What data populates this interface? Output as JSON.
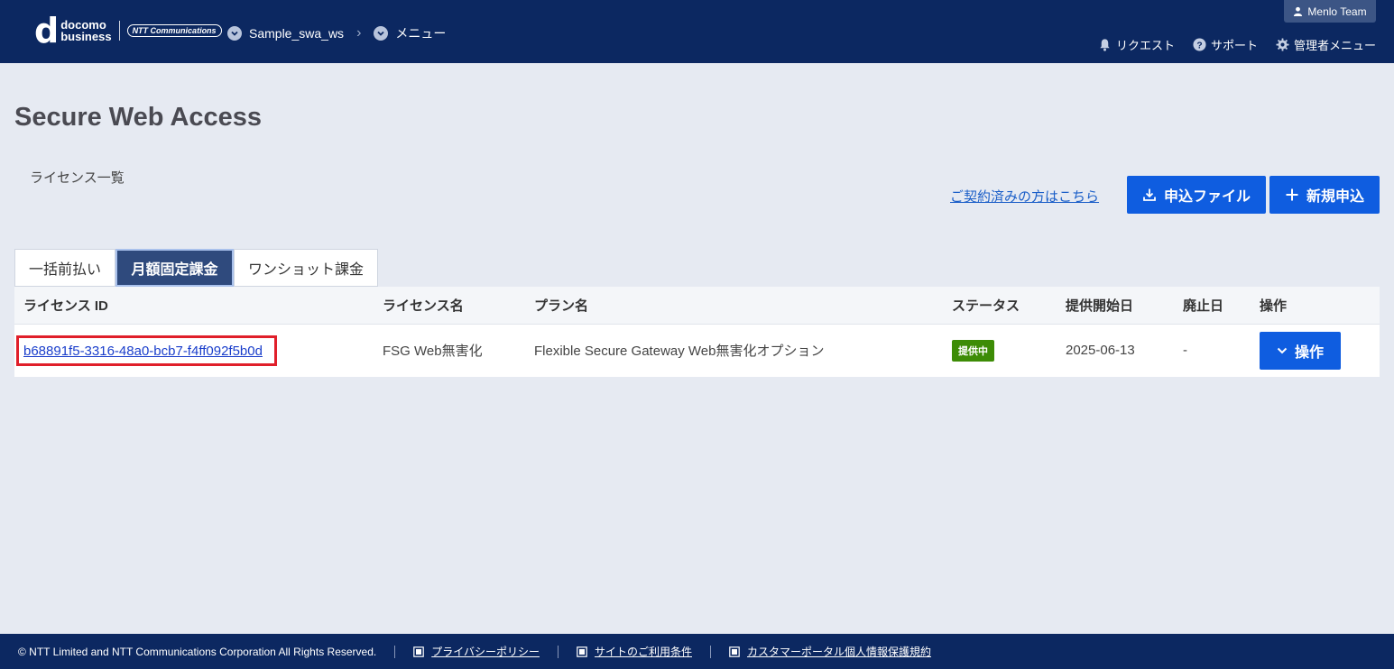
{
  "header": {
    "logo": {
      "brand_top": "docomo",
      "brand_bottom": "business",
      "partner": "NTT Communications"
    },
    "breadcrumb": [
      {
        "label": "Sample_swa_ws"
      },
      {
        "label": "メニュー"
      }
    ],
    "user": "Menlo Team",
    "links": {
      "request": "リクエスト",
      "support": "サポート",
      "admin": "管理者メニュー"
    }
  },
  "page": {
    "title": "Secure Web Access",
    "subtitle": "ライセンス一覧",
    "contract_link": "ご契約済みの方はこちら",
    "btn_file": "申込ファイル",
    "btn_new": "新規申込"
  },
  "tabs": [
    {
      "label": "一括前払い",
      "active": false
    },
    {
      "label": "月額固定課金",
      "active": true
    },
    {
      "label": "ワンショット課金",
      "active": false
    }
  ],
  "table": {
    "headers": [
      "ライセンス ID",
      "ライセンス名",
      "プラン名",
      "ステータス",
      "提供開始日",
      "廃止日",
      "操作"
    ],
    "rows": [
      {
        "license_id": "b68891f5-3316-48a0-bcb7-f4ff092f5b0d",
        "license_name": "FSG Web無害化",
        "plan_name": "Flexible Secure Gateway Web無害化オプション",
        "status": "提供中",
        "start_date": "2025-06-13",
        "end_date": "-",
        "action": "操作"
      }
    ]
  },
  "footer": {
    "copyright": "© NTT Limited and NTT Communications Corporation All Rights Reserved.",
    "links": [
      "プライバシーポリシー",
      "サイトのご利用条件",
      "カスタマーポータル個人情報保護規約"
    ]
  },
  "colors": {
    "header_bg": "#0c2861",
    "primary": "#0f5de0",
    "status_active": "#3d8c06",
    "highlight": "#e01f2a"
  }
}
